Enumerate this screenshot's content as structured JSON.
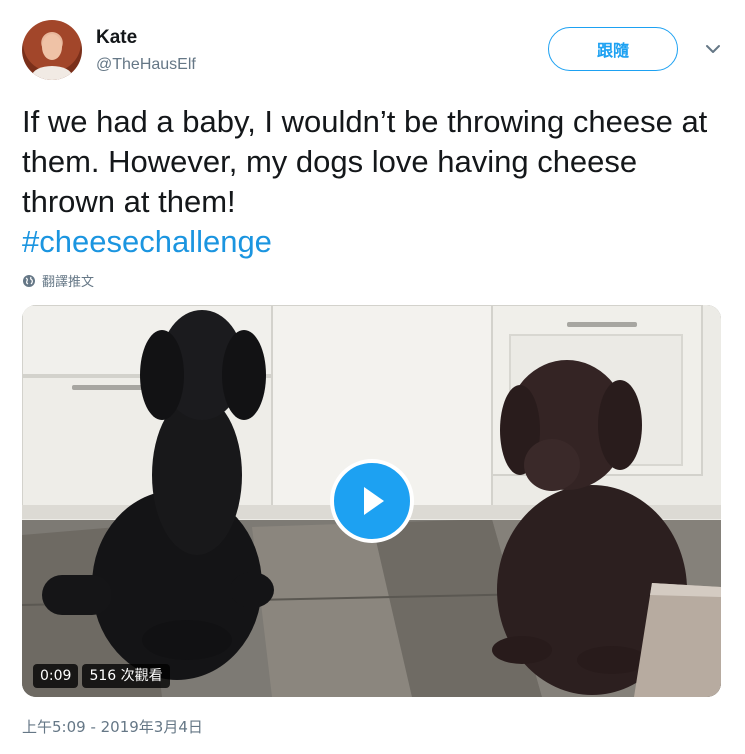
{
  "user": {
    "name": "Kate",
    "handle": "@TheHausElf",
    "follow_label": "跟隨"
  },
  "tweet": {
    "text": "If we had a baby, I wouldn’t be throwing cheese at them. However, my dogs love having cheese thrown at them!",
    "hashtag": "#cheesechallenge",
    "translate_label": "翻譯推文"
  },
  "video": {
    "duration": "0:09",
    "views": "516 次觀看"
  },
  "timestamp": "上午5:09 - 2019年3月4日",
  "colors": {
    "accent": "#1da1f2",
    "hashtag": "#1b95e0",
    "muted": "#657786"
  },
  "icons": {
    "caret": "chevron-down-icon",
    "globe": "globe-icon",
    "play": "play-icon"
  }
}
